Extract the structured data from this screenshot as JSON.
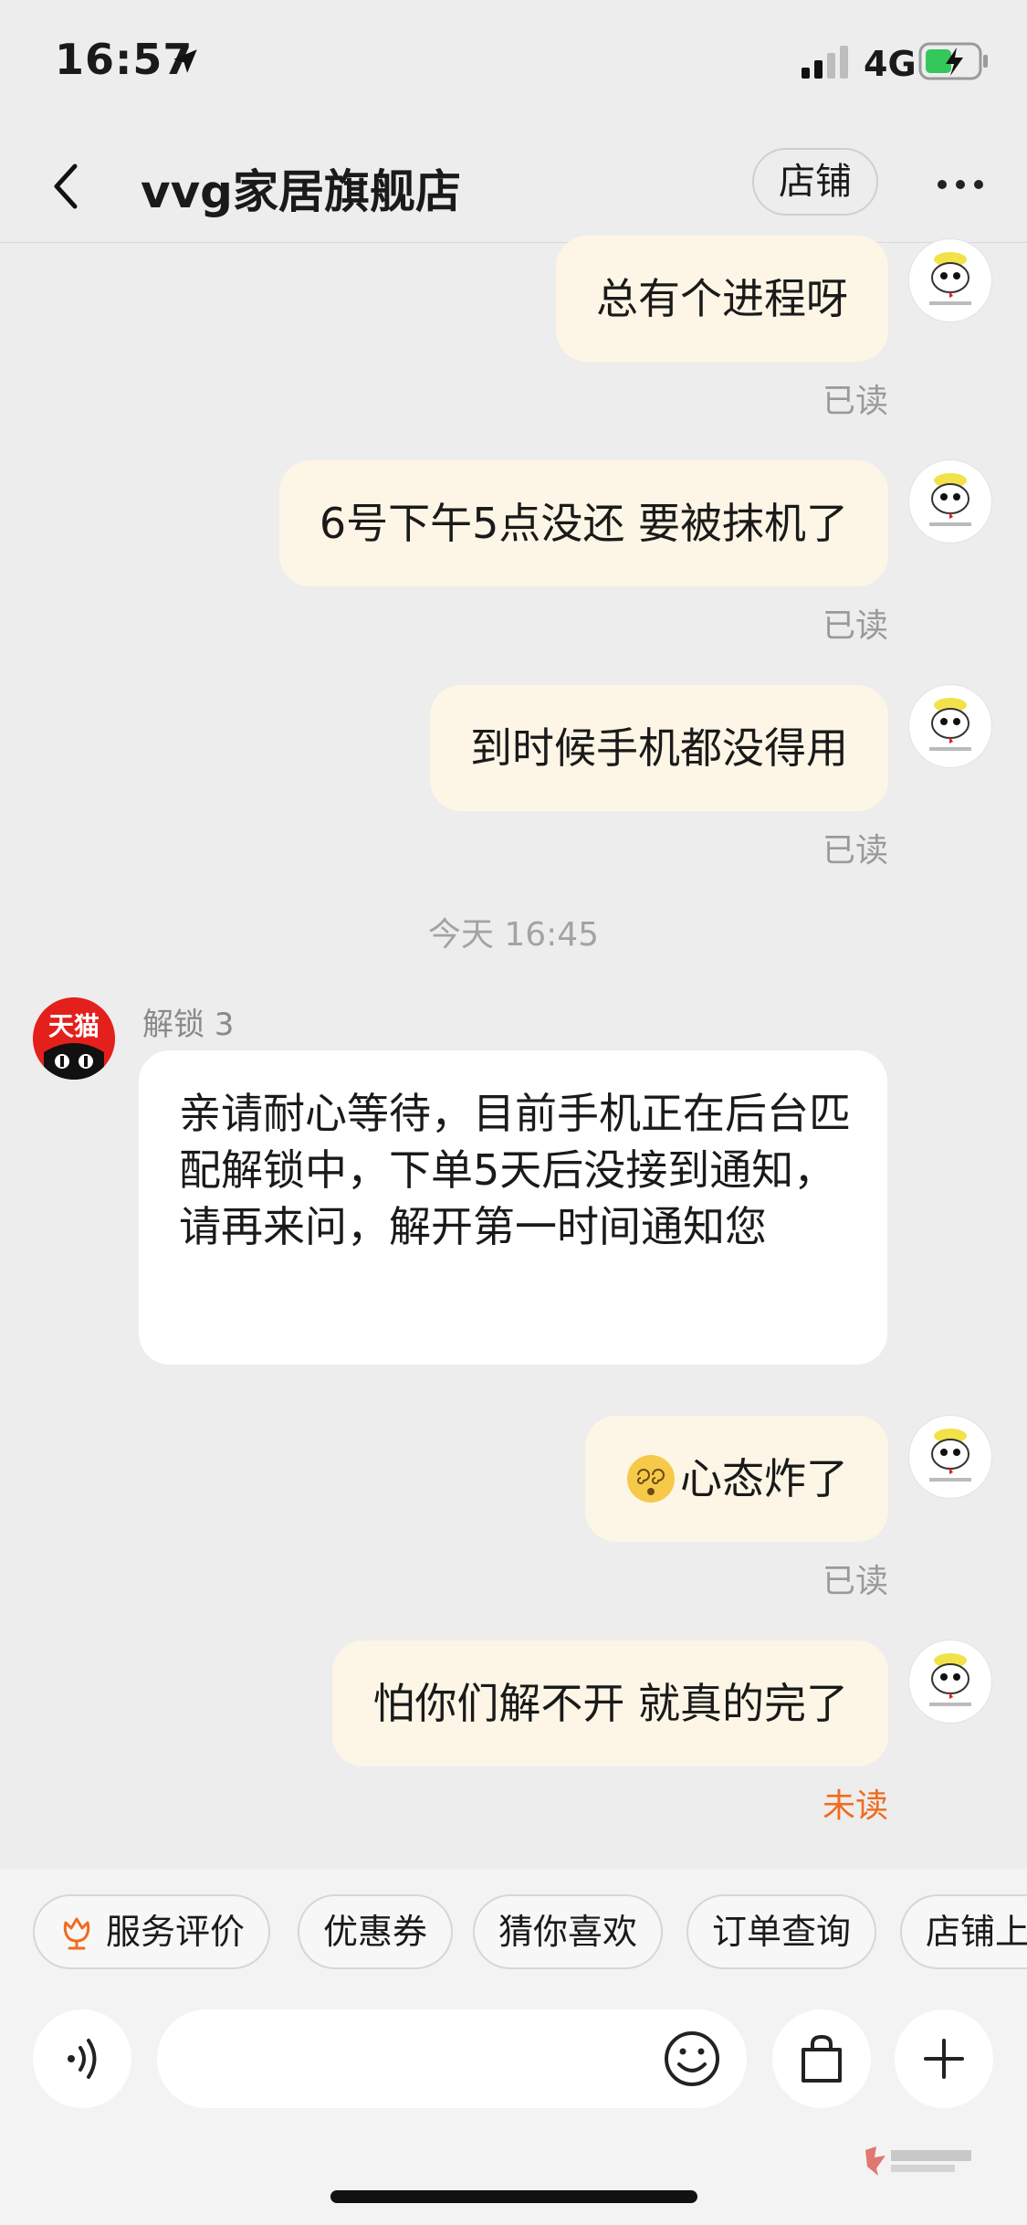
{
  "status_bar": {
    "time": "16:57",
    "network": "4G"
  },
  "nav": {
    "title": "vvg家居旗舰店",
    "shop_button": "店铺"
  },
  "messages": [
    {
      "text": "总有个进程呀",
      "status": "已读"
    },
    {
      "text": "6号下午5点没还 要被抹机了",
      "status": "已读"
    },
    {
      "text": "到时候手机都没得用",
      "status": "已读"
    }
  ],
  "time_divider": "今天 16:45",
  "incoming": {
    "avatar_label": "天猫",
    "sender": "解锁 3",
    "text": "亲请耐心等待，目前手机正在后台匹配解锁中，下单5天后没接到通知，请再来问，解开第一时间通知您"
  },
  "messages_after": [
    {
      "emoji": "dizzy-face",
      "text": "心态炸了",
      "status": "已读"
    },
    {
      "text": "怕你们解不开 就真的完了",
      "status": "未读"
    }
  ],
  "quick_actions": [
    "服务评价",
    "优惠券",
    "猜你喜欢",
    "订单查询",
    "店铺上新"
  ],
  "input": {
    "placeholder": ""
  },
  "colors": {
    "outgoing_bubble": "#fdf6e6",
    "unread": "#f06b1e",
    "tmall_red": "#e3201c"
  },
  "icons": [
    "location-arrow-icon",
    "signal-icon",
    "battery-charging-icon",
    "back-icon",
    "more-icon",
    "voice-icon",
    "emoji-icon",
    "bag-icon",
    "plus-icon",
    "flower-icon"
  ]
}
